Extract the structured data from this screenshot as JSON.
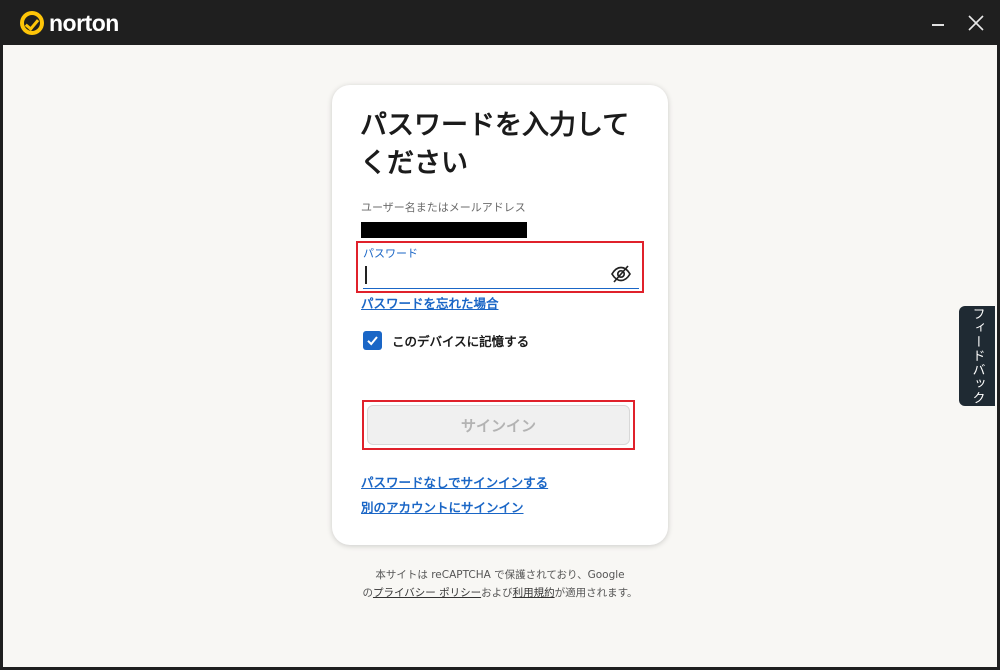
{
  "app": {
    "brand": "norton",
    "brand_color": "#fec508"
  },
  "window_controls": {
    "minimize_icon": "minimize-icon",
    "close_icon": "close-icon"
  },
  "login": {
    "heading": "パスワードを入力してください",
    "username_label": "ユーザー名またはメールアドレス",
    "password_label": "パスワード",
    "password_value": "",
    "toggle_visibility_icon": "eye-slash-icon",
    "forgot_password": "パスワードを忘れた場合",
    "remember_device": "このデバイスに記憶する",
    "remember_checked": true,
    "signin_button": "サインイン",
    "passwordless_link": "パスワードなしでサインインする",
    "other_account_link": "別のアカウントにサインイン"
  },
  "footer": {
    "line1": "本サイトは reCAPTCHA で保護されており、Google",
    "line2_prefix": "の",
    "privacy_link": "プライバシー ポリシー",
    "line2_mid": "および",
    "terms_link": "利用規約",
    "line2_suffix": "が適用されます。"
  },
  "feedback": {
    "label": "フィードバック"
  },
  "colors": {
    "titlebar": "#1f1f1f",
    "link": "#1a66c6",
    "highlight_border": "#e0212b"
  }
}
